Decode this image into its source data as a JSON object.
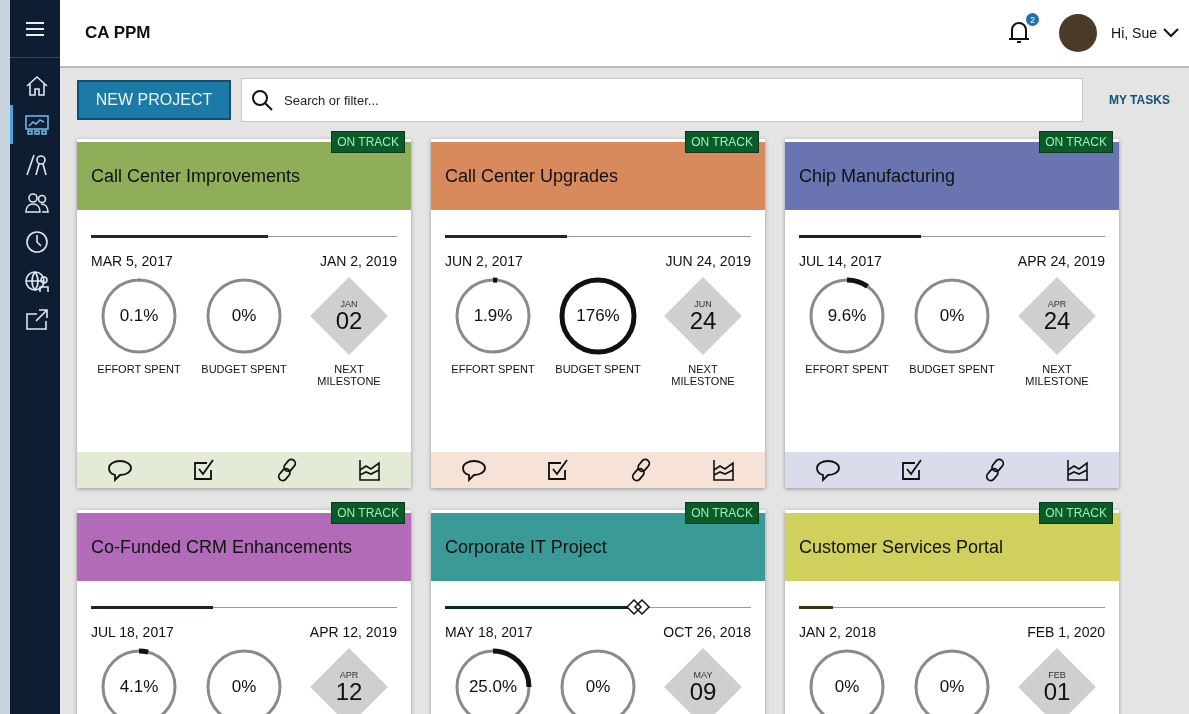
{
  "app_title": "CA PPM",
  "header": {
    "notification_count": "2",
    "greeting": "Hi, Sue"
  },
  "sidebar": {
    "items": [
      {
        "kind": "home",
        "selected": false
      },
      {
        "kind": "chart",
        "selected": true
      },
      {
        "kind": "compass",
        "selected": false
      },
      {
        "kind": "people",
        "selected": false
      },
      {
        "kind": "clock",
        "selected": false
      },
      {
        "kind": "globe",
        "selected": false
      },
      {
        "kind": "export",
        "selected": false
      }
    ]
  },
  "toolbar": {
    "new_button": "NEW PROJECT",
    "search": {
      "placeholder": "Search or filter..."
    },
    "my_tasks": "MY TASKS"
  },
  "projects": [
    {
      "name": "Call Center Improvements",
      "color": "#8fae5a",
      "status": "ON TRACK",
      "level": 0.58,
      "marker": false,
      "start": "MAR 5, 2017",
      "end": "JAN 2, 2019",
      "metrics": [
        {
          "value": "0.1%",
          "level": 0.001,
          "label": "EFFORT SPENT"
        },
        {
          "value": "0%",
          "level": 0,
          "label": "BUDGET SPENT"
        }
      ],
      "milestone": {
        "month": "JAN",
        "day": "02",
        "label": "NEXT MILESTONE"
      }
    },
    {
      "name": "Call Center Upgrades",
      "color": "#d98a5c",
      "status": "ON TRACK",
      "level": 0.4,
      "marker": false,
      "start": "JUN 2, 2017",
      "end": "JUN 24, 2019",
      "metrics": [
        {
          "value": "1.9%",
          "level": 0.019,
          "label": "EFFORT SPENT"
        },
        {
          "value": "176%",
          "level": 1,
          "label": "BUDGET SPENT"
        }
      ],
      "milestone": {
        "month": "JUN",
        "day": "24",
        "label": "NEXT MILESTONE"
      }
    },
    {
      "name": "Chip Manufacturing",
      "color": "#6a74b0",
      "status": "ON TRACK",
      "level": 0.4,
      "marker": false,
      "start": "JUL 14, 2017",
      "end": "APR 24, 2019",
      "metrics": [
        {
          "value": "9.6%",
          "level": 0.096,
          "label": "EFFORT SPENT"
        },
        {
          "value": "0%",
          "level": 0,
          "label": "BUDGET SPENT"
        }
      ],
      "milestone": {
        "month": "APR",
        "day": "24",
        "label": "NEXT MILESTONE"
      }
    },
    {
      "name": "Co-Funded CRM Enhancements",
      "color": "#b26bb8",
      "status": "ON TRACK",
      "level": 0.4,
      "marker": false,
      "start": "JUL 18, 2017",
      "end": "APR 12, 2019",
      "metrics": [
        {
          "value": "4.1%",
          "level": 0.041
        },
        {
          "value": "0%",
          "level": 0
        }
      ],
      "milestone": {
        "month": "APR",
        "day": "12"
      }
    },
    {
      "name": "Corporate IT Project",
      "color": "#3a9a98",
      "status": "ON TRACK",
      "level": 0.6,
      "marker": true,
      "start": "MAY 18, 2017",
      "end": "OCT 26, 2018",
      "metrics": [
        {
          "value": "25.0%",
          "level": 0.25
        },
        {
          "value": "0%",
          "level": 0
        }
      ],
      "milestone": {
        "month": "MAY",
        "day": "09"
      }
    },
    {
      "name": "Customer Services Portal",
      "color": "#cfd15c",
      "status": "ON TRACK",
      "level": 0.11,
      "marker": false,
      "start": "JAN 2, 2018",
      "end": "FEB 1, 2020",
      "metrics": [
        {
          "value": "0%",
          "level": 0
        },
        {
          "value": "0%",
          "level": 0
        }
      ],
      "milestone": {
        "month": "FEB",
        "day": "01"
      }
    }
  ]
}
